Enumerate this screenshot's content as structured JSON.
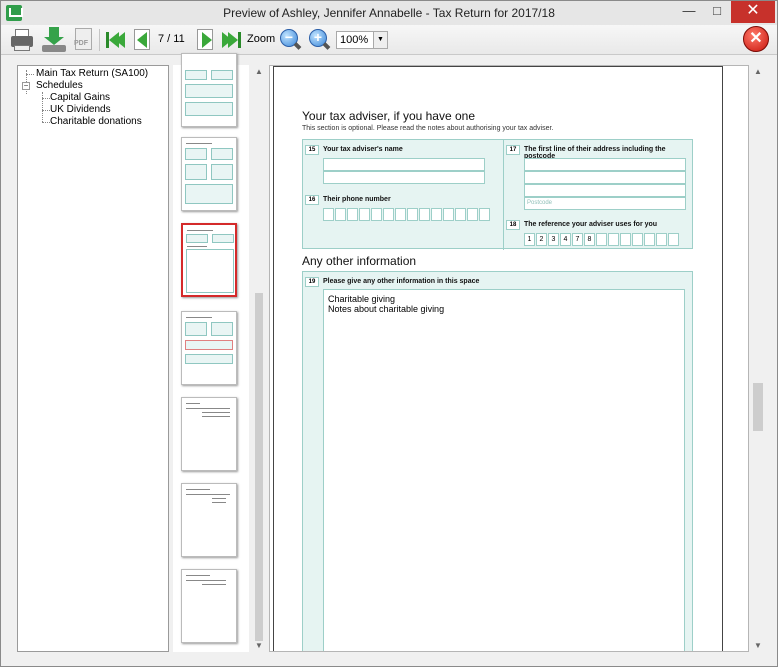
{
  "window": {
    "title": "Preview of Ashley, Jennifer Annabelle - Tax Return for 2017/18"
  },
  "toolbar": {
    "page_indicator": "7 / 11",
    "zoom_label": "Zoom",
    "zoom_value": "100%",
    "pdf_label": "PDF"
  },
  "tree": {
    "items": [
      {
        "label": "Main Tax Return (SA100)"
      },
      {
        "label": "Schedules"
      },
      {
        "label": "Capital Gains"
      },
      {
        "label": "UK Dividends"
      },
      {
        "label": "Charitable donations"
      }
    ]
  },
  "page": {
    "adviser_title": "Your tax adviser, if you have one",
    "adviser_note": "This section is optional. Please read the notes about authorising your tax adviser.",
    "q15_num": "15",
    "q15_label": "Your tax adviser's name",
    "q16_num": "16",
    "q16_label": "Their phone number",
    "q17_num": "17",
    "q17_label": "The first line of their address including the postcode",
    "postcode_label": "Postcode",
    "q18_num": "18",
    "q18_label": "The reference your adviser uses for you",
    "reference_digits": [
      "1",
      "2",
      "3",
      "4",
      "7",
      "8"
    ],
    "other_title": "Any other information",
    "q19_num": "19",
    "q19_label": "Please give any other information in this space",
    "other_lines": [
      "Charitable giving",
      "Notes about charitable giving"
    ]
  }
}
